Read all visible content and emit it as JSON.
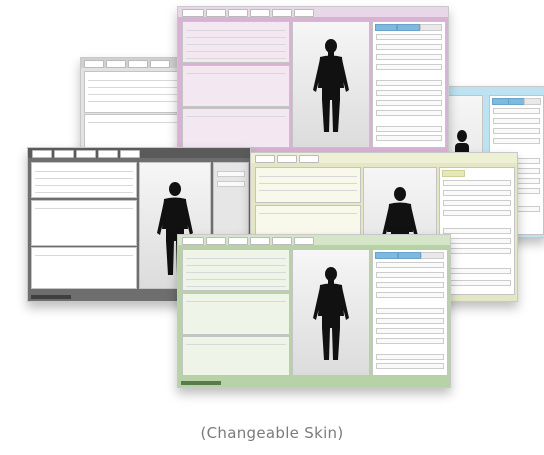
{
  "caption": "(Changeable Skin)",
  "skins": [
    {
      "id": "pink",
      "bg": "#d8b2d3",
      "panel": "#f3e8f1"
    },
    {
      "id": "white",
      "bg": "#e2e2e2",
      "panel": "#f7f7f7"
    },
    {
      "id": "blue",
      "bg": "#bde2f1",
      "panel": "#eef8fc"
    },
    {
      "id": "dark",
      "bg": "#6e6e6e",
      "panel": "#9a9a9a"
    },
    {
      "id": "yellow",
      "bg": "#e4e6c4",
      "panel": "#f8f9ea"
    },
    {
      "id": "green",
      "bg": "#b7d2a6",
      "panel": "#eef5e8"
    }
  ],
  "icons": {
    "body_figure": "human-silhouette-icon"
  }
}
